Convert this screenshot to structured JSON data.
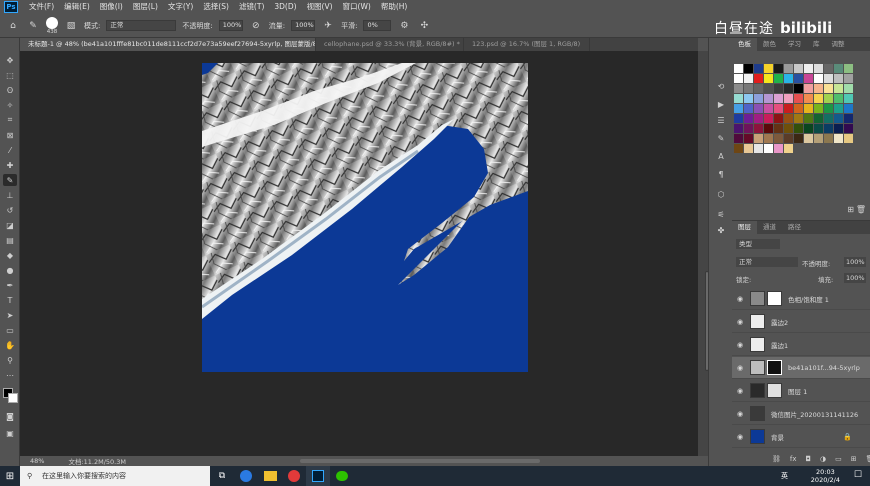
{
  "app": {
    "logo": "Ps"
  },
  "menu": [
    "文件(F)",
    "编辑(E)",
    "图像(I)",
    "图层(L)",
    "文字(Y)",
    "选择(S)",
    "滤镜(T)",
    "3D(D)",
    "视图(V)",
    "窗口(W)",
    "帮助(H)"
  ],
  "options": {
    "brush_size": "438",
    "mode_label": "模式:",
    "mode_value": "正常",
    "opacity_label": "不透明度:",
    "opacity_value": "100%",
    "flow_label": "流量:",
    "flow_value": "100%",
    "smooth_label": "平滑:",
    "smooth_value": "0%"
  },
  "tabs": [
    {
      "label": "未标题-1 @ 48% (be41a101fffe81bc011de8111ccf2d7e73a59eef27694-5xyrlp, 图层蒙版/8) *"
    },
    {
      "label": "cellophane.psd @ 33.3% (背景, RGB/8#) *"
    },
    {
      "label": "123.psd @ 16.7% (图层 1, RGB/8)"
    }
  ],
  "status": {
    "zoom": "48%",
    "doc": "文档:11.2M/50.3M"
  },
  "watermark": {
    "text": "白昼在途",
    "brand": "bilibili"
  },
  "swatches": {
    "tabs": [
      "色板",
      "颜色",
      "学习",
      "库",
      "调整"
    ],
    "colors": [
      "#ffffff",
      "#000000",
      "#1e3c8c",
      "#f5d22a",
      "#1a1a1a",
      "#9a9a9a",
      "#c8c8c8",
      "#eeeeee",
      "#dddddd",
      "#666666",
      "#5a8c7a",
      "#8cbe82",
      "#ffffff",
      "#f2f2f2",
      "#e01e1e",
      "#f5e61e",
      "#21b24b",
      "#2ab4e6",
      "#2850a0",
      "#c84696",
      "#ffffff",
      "#dcdcdc",
      "#bebebe",
      "#a0a0a0",
      "#8c8c8c",
      "#787878",
      "#646464",
      "#505050",
      "#3c3c3c",
      "#282828",
      "#000000",
      "#f0a0a0",
      "#f5b48c",
      "#fae196",
      "#c8e696",
      "#a0dcaa",
      "#96dcd2",
      "#8cc8f0",
      "#8ca0dc",
      "#b496d2",
      "#dca0d2",
      "#f0a0be",
      "#e65050",
      "#f08c50",
      "#f5d250",
      "#a0d250",
      "#50be6e",
      "#50c8b4",
      "#46a0e6",
      "#5064c8",
      "#8c50b4",
      "#c850a0",
      "#e6507e",
      "#c81e1e",
      "#d2641e",
      "#e6b41e",
      "#78b41e",
      "#1e9646",
      "#1ea08c",
      "#1e78c8",
      "#1e3ca0",
      "#6e1e96",
      "#a01e82",
      "#c81e5a",
      "#8c1414",
      "#965014",
      "#a07814",
      "#507814",
      "#146432",
      "#146e64",
      "#145a8c",
      "#14286e",
      "#4b146e",
      "#6e145a",
      "#8c143c",
      "#5a0a0a",
      "#643214",
      "#6e500a",
      "#32500a",
      "#0a4620",
      "#0a4a46",
      "#0a3c64",
      "#0a1e50",
      "#320a50",
      "#500a3c",
      "#640a28",
      "#c8a078",
      "#a07850",
      "#7d5a3c",
      "#5a3c28",
      "#3c2814",
      "#dcc8a0",
      "#b4a078",
      "#8c7850",
      "#f0e6c8",
      "#e6c882",
      "#6e4614",
      "#e8c896",
      "#e6e6e6",
      "#ffffff",
      "#e896c8",
      "#f0d28c"
    ]
  },
  "layers": {
    "tabs": [
      "图层",
      "通道",
      "路径"
    ],
    "kind": "类型",
    "blend": "正常",
    "opacity_label": "不透明度:",
    "opacity": "100%",
    "lock_label": "锁定:",
    "fill_label": "填充:",
    "fill": "100%",
    "items": [
      {
        "name": "色相/饱和度 1"
      },
      {
        "name": "露边2"
      },
      {
        "name": "露边1"
      },
      {
        "name": "be41a101f...94-5xyrlp"
      },
      {
        "name": "图层 1"
      },
      {
        "name": "微信图片_20200131141126"
      },
      {
        "name": "背景"
      }
    ]
  },
  "taskbar": {
    "search_placeholder": "在这里输入你要搜索的内容",
    "lang": "英",
    "time": "20:03",
    "date": "2020/2/4"
  }
}
